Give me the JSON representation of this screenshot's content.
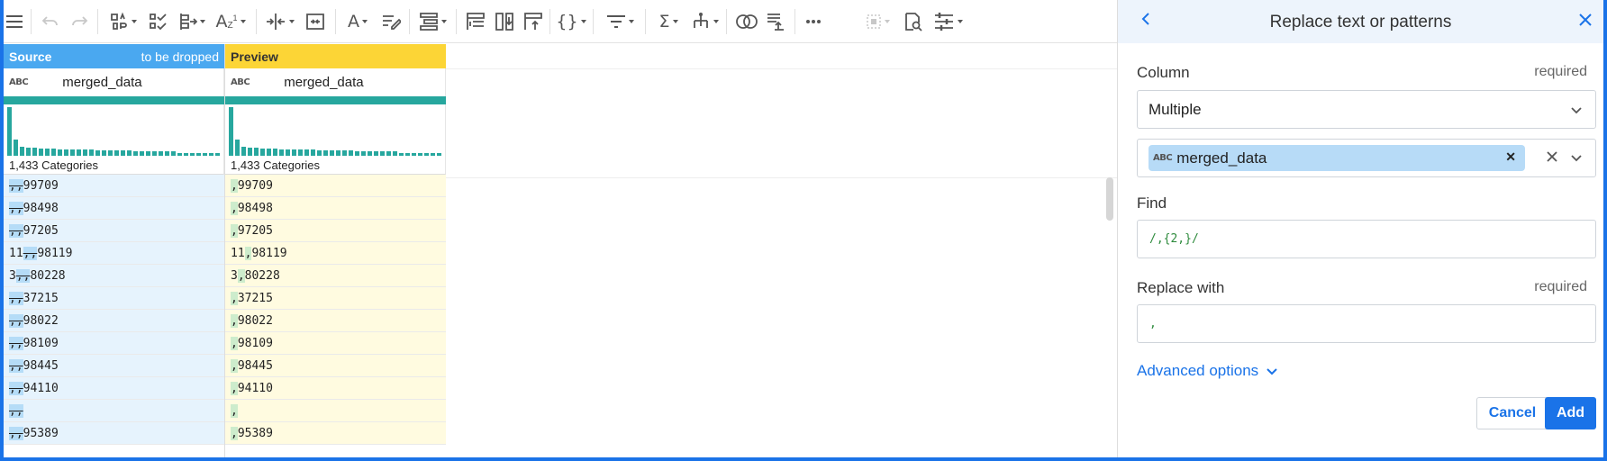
{
  "toolbar": {
    "icons": [
      "menu-icon",
      "undo-icon",
      "redo-icon",
      "change-type-icon",
      "validate-icon",
      "format-icon",
      "rename-icon",
      "split-column-icon",
      "merge-columns-icon",
      "text-format-icon",
      "edit-icon",
      "restructure-icon",
      "nest-icon",
      "unnest-icon",
      "expand-icon",
      "json-icon",
      "filter-icon",
      "aggregate-icon",
      "pivot-icon",
      "join-icon",
      "sort-icon",
      "more-icon",
      "select-icon",
      "search-icon",
      "settings-icon"
    ],
    "font_label": "A",
    "sort_label": "A",
    "sort_sub": "Z",
    "sort_num": "1",
    "json_label": "{}",
    "sigma_label": "Σ"
  },
  "grid": {
    "source": {
      "tag": "Source",
      "status": "to be dropped",
      "type": "ABC",
      "name": "merged_data",
      "categories": "1,433 Categories",
      "rows": [
        {
          "pre": "",
          "hl": ",,",
          "post": "99709"
        },
        {
          "pre": "",
          "hl": ",,",
          "post": "98498"
        },
        {
          "pre": "",
          "hl": ",,",
          "post": "97205"
        },
        {
          "pre": "11",
          "hl": ",,",
          "post": "98119"
        },
        {
          "pre": "3",
          "hl": ",,",
          "post": "80228"
        },
        {
          "pre": "",
          "hl": ",,",
          "post": "37215"
        },
        {
          "pre": "",
          "hl": ",,",
          "post": "98022"
        },
        {
          "pre": "",
          "hl": ",,",
          "post": "98109"
        },
        {
          "pre": "",
          "hl": ",,",
          "post": "98445"
        },
        {
          "pre": "",
          "hl": ",,",
          "post": "94110"
        },
        {
          "pre": "",
          "hl": ",,",
          "post": ""
        },
        {
          "pre": "",
          "hl": ",,",
          "post": "95389"
        }
      ]
    },
    "preview": {
      "tag": "Preview",
      "type": "ABC",
      "name": "merged_data",
      "categories": "1,433 Categories",
      "rows": [
        {
          "pre": "",
          "hl": ",",
          "post": "99709"
        },
        {
          "pre": "",
          "hl": ",",
          "post": "98498"
        },
        {
          "pre": "",
          "hl": ",",
          "post": "97205"
        },
        {
          "pre": "11",
          "hl": ",",
          "post": "98119"
        },
        {
          "pre": "3",
          "hl": ",",
          "post": "80228"
        },
        {
          "pre": "",
          "hl": ",",
          "post": "37215"
        },
        {
          "pre": "",
          "hl": ",",
          "post": "98022"
        },
        {
          "pre": "",
          "hl": ",",
          "post": "98109"
        },
        {
          "pre": "",
          "hl": ",",
          "post": "98445"
        },
        {
          "pre": "",
          "hl": ",",
          "post": "94110"
        },
        {
          "pre": "",
          "hl": ",",
          "post": ""
        },
        {
          "pre": "",
          "hl": ",",
          "post": "95389"
        }
      ]
    },
    "histogram": [
      48,
      16,
      9,
      8,
      8,
      7,
      7,
      7,
      6,
      6,
      6,
      6,
      6,
      6,
      5,
      5,
      5,
      5,
      5,
      5,
      4,
      4,
      4,
      4,
      4,
      4,
      4,
      3,
      3,
      3,
      3,
      3,
      3,
      3
    ]
  },
  "panel": {
    "title": "Replace text or patterns",
    "column_label": "Column",
    "column_required": "required",
    "column_mode": "Multiple",
    "chip_type": "ABC",
    "chip_name": "merged_data",
    "find_label": "Find",
    "find_value": "/,{2,}/",
    "replace_label": "Replace with",
    "replace_required": "required",
    "replace_value": ",",
    "advanced": "Advanced options",
    "cancel": "Cancel",
    "add": "Add"
  },
  "colors": {
    "accent": "#1a73e8",
    "source_header": "#4aa8f0",
    "preview_header": "#fcd536",
    "teal": "#27a79e",
    "source_cell": "#e6f3fd",
    "preview_cell": "#fffbe0"
  }
}
